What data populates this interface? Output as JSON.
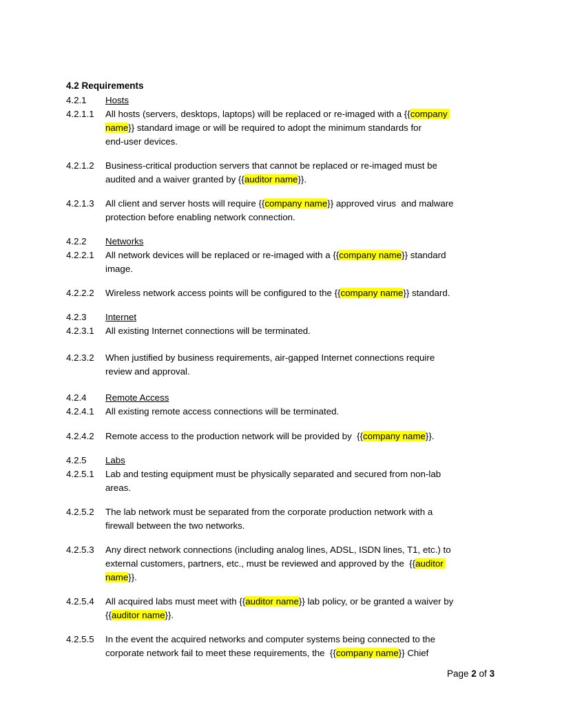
{
  "document": {
    "section_heading": "4.2  Requirements",
    "highlight_color": "#ffff00",
    "blocks": [
      {
        "type": "subsection",
        "number": "4.2.1",
        "title": "Hosts"
      },
      {
        "type": "item",
        "number": "4.2.1.1",
        "lines": [
          [
            {
              "t": "All hosts (servers, desktops, laptops) will be replaced or re-imaged with a {{"
            },
            {
              "h": "company "
            }
          ],
          [
            {
              "h": "name"
            },
            {
              "t": "}} standard image or will be required to adopt the minimum standards for"
            }
          ],
          [
            {
              "t": "end-user devices."
            }
          ]
        ]
      },
      {
        "type": "item",
        "number": "4.2.1.2",
        "lines": [
          [
            {
              "t": "Business-critical production servers that cannot be replaced or re-imaged must be"
            }
          ],
          [
            {
              "t": "audited and a waiver granted by {{"
            },
            {
              "h": "auditor name"
            },
            {
              "t": "}}."
            }
          ]
        ]
      },
      {
        "type": "item",
        "number": "4.2.1.3",
        "lines": [
          [
            {
              "t": "All client and server hosts will require {{"
            },
            {
              "h": "company name"
            },
            {
              "t": "}} approved virus  and malware"
            }
          ],
          [
            {
              "t": "protection before enabling network connection."
            }
          ]
        ]
      },
      {
        "type": "subsection",
        "number": "4.2.2",
        "title": "Networks"
      },
      {
        "type": "item",
        "number": "4.2.2.1",
        "lines": [
          [
            {
              "t": "All network devices will be replaced or re-imaged with a {{"
            },
            {
              "h": "company name"
            },
            {
              "t": "}} standard"
            }
          ],
          [
            {
              "t": "image."
            }
          ]
        ]
      },
      {
        "type": "item",
        "number": "4.2.2.2",
        "lines": [
          [
            {
              "t": "Wireless network access points will be configured to the {{"
            },
            {
              "h": "company name"
            },
            {
              "t": "}} standard."
            }
          ]
        ]
      },
      {
        "type": "subsection",
        "number": "4.2.3",
        "title": "Internet"
      },
      {
        "type": "item",
        "number": "4.2.3.1",
        "lines": [
          [
            {
              "t": "All existing Internet connections will be terminated."
            }
          ]
        ]
      },
      {
        "type": "item",
        "number": "4.2.3.2",
        "lines": [
          [
            {
              "t": "When justified by business requirements, air-gapped Internet connections require"
            }
          ],
          [
            {
              "t": "review and approval."
            }
          ]
        ]
      },
      {
        "type": "subsection",
        "number": "4.2.4",
        "title": "Remote Access"
      },
      {
        "type": "item",
        "number": "4.2.4.1",
        "lines": [
          [
            {
              "t": "All existing remote access connections will be terminated."
            }
          ]
        ]
      },
      {
        "type": "item",
        "number": "4.2.4.2",
        "lines": [
          [
            {
              "t": "Remote access to the production network will be provided by  {{"
            },
            {
              "h": "company name"
            },
            {
              "t": "}}."
            }
          ]
        ]
      },
      {
        "type": "subsection",
        "number": "4.2.5",
        "title": "Labs"
      },
      {
        "type": "item",
        "number": "4.2.5.1",
        "lines": [
          [
            {
              "t": "Lab and testing equipment must be physically separated and secured from non-lab"
            }
          ],
          [
            {
              "t": "areas."
            }
          ]
        ]
      },
      {
        "type": "item",
        "number": "4.2.5.2",
        "lines": [
          [
            {
              "t": "The lab network must be separated from the corporate production network with a"
            }
          ],
          [
            {
              "t": "firewall between the two networks."
            }
          ]
        ]
      },
      {
        "type": "item",
        "number": "4.2.5.3",
        "lines": [
          [
            {
              "t": "Any direct network connections (including analog lines, ADSL, ISDN lines, T1, etc.) to"
            }
          ],
          [
            {
              "t": "external customers, partners, etc., must be reviewed and approved by the  {{"
            },
            {
              "h": "auditor "
            }
          ],
          [
            {
              "h": "name"
            },
            {
              "t": "}}."
            }
          ]
        ]
      },
      {
        "type": "item",
        "number": "4.2.5.4",
        "lines": [
          [
            {
              "t": "All acquired labs must meet with {{"
            },
            {
              "h": "auditor name"
            },
            {
              "t": "}} lab policy, or be granted a waiver by"
            }
          ],
          [
            {
              "t": "{{"
            },
            {
              "h": "auditor name"
            },
            {
              "t": "}}."
            }
          ]
        ]
      },
      {
        "type": "item",
        "number": "4.2.5.5",
        "lines": [
          [
            {
              "t": "In the event the acquired networks and computer systems being connected to the"
            }
          ],
          [
            {
              "t": "corporate network fail to meet these requirements, the  {{"
            },
            {
              "h": "company name"
            },
            {
              "t": "}} Chief"
            }
          ]
        ]
      }
    ]
  },
  "footer": {
    "page_label": "Page ",
    "current_page": "2",
    "of_label": " of ",
    "total_pages": "3"
  }
}
